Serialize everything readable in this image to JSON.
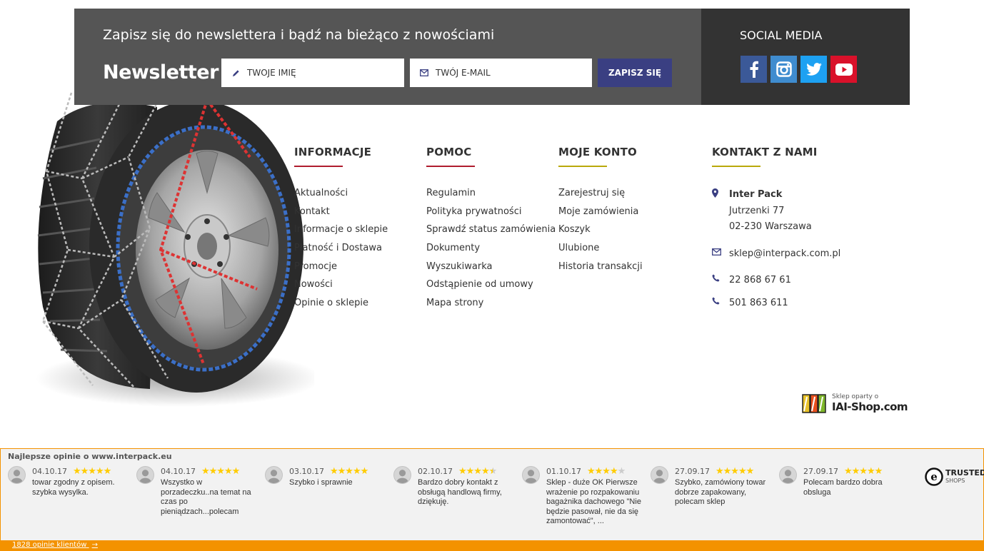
{
  "newsletter": {
    "heading": "Zapisz się do newslettera i bądź na bieżąco z nowościami",
    "title": "Newsletter",
    "name_placeholder": "TWOJE IMIĘ",
    "email_placeholder": "TWÓJ E-MAIL",
    "submit_label": "ZAPISZ SIĘ"
  },
  "social": {
    "title": "SOCIAL MEDIA",
    "icons": [
      "facebook-icon",
      "instagram-icon",
      "twitter-icon",
      "youtube-icon"
    ]
  },
  "columns": {
    "info": {
      "title": "INFORMACJE",
      "accent": "#b01c2e",
      "items": [
        "Aktualności",
        "Kontakt",
        "Informacje o sklepie",
        "Płatność i Dostawa",
        "Promocje",
        "Nowości",
        "Opinie o sklepie"
      ]
    },
    "help": {
      "title": "POMOC",
      "accent": "#b01c2e",
      "items": [
        "Regulamin",
        "Polityka prywatności",
        "Sprawdź status zamówienia",
        "Dokumenty",
        "Wyszukiwarka",
        "Odstąpienie od umowy",
        "Mapa strony"
      ]
    },
    "account": {
      "title": "MOJE KONTO",
      "accent": "#b9a90b",
      "items": [
        "Zarejestruj się",
        "Moje zamówienia",
        "Koszyk",
        "Ulubione",
        "Historia transakcji"
      ]
    },
    "contact": {
      "title": "KONTAKT Z NAMI",
      "accent": "#b9a90b",
      "company": "Inter Pack",
      "street": "Jutrzenki 77",
      "city": "02-230 Warszawa",
      "email": "sklep@interpack.com.pl",
      "phone1": "22 868 67 61",
      "phone2": "501 863 611"
    }
  },
  "iai": {
    "small": "Sklep oparty o",
    "big": "IAI-Shop.com"
  },
  "reviews": {
    "header": "Najlepsze opinie o www.interpack.eu",
    "items": [
      {
        "date": "04.10.17",
        "rating": 5,
        "text": "towar zgodny z opisem. szybka wysylka."
      },
      {
        "date": "04.10.17",
        "rating": 5,
        "text": "Wszystko w porzadeczku..na temat na czas po pieniądzach...polecam"
      },
      {
        "date": "03.10.17",
        "rating": 5,
        "text": "Szybko i sprawnie"
      },
      {
        "date": "02.10.17",
        "rating": 4.5,
        "text": "Bardzo dobry kontakt z obsługą handlową firmy, dziękuję."
      },
      {
        "date": "01.10.17",
        "rating": 4,
        "text": "Sklep - duże OK Pierwsze wrażenie po rozpakowaniu bagażnika dachowego \"Nie będzie pasował, nie da się zamontować\", ..."
      },
      {
        "date": "27.09.17",
        "rating": 5,
        "text": "Szybko, zamówiony towar dobrze zapakowany, polecam sklep"
      },
      {
        "date": "27.09.17",
        "rating": 5,
        "text": "Polecam bardzo dobra obsluga"
      }
    ],
    "trusted_main": "TRUSTED",
    "trusted_sub": "SHOPS",
    "footer_link": "1828 opinie klientów",
    "footer_arrow": "→"
  }
}
